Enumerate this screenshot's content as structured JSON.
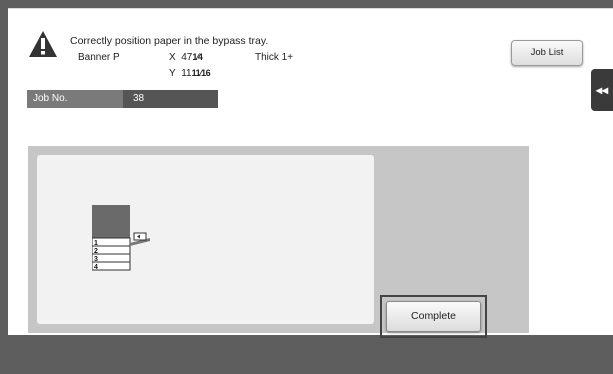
{
  "message": {
    "text": "Correctly position paper in the bypass tray.",
    "paper_name": "Banner P",
    "x_label": "X",
    "x_whole": "47",
    "x_fraction": "1⁄4",
    "y_label": "Y",
    "y_whole": "11",
    "y_fraction": "11⁄16",
    "paper_type": "Thick 1+"
  },
  "job": {
    "label": "Job No.",
    "number": "38"
  },
  "buttons": {
    "job_list": "Job List",
    "complete": "Complete",
    "side_tab_glyph": "◂◂"
  },
  "illustration": {
    "tray_numbers": [
      "1",
      "2",
      "3",
      "4"
    ]
  },
  "icons": {
    "warning": "warning-triangle-icon"
  }
}
